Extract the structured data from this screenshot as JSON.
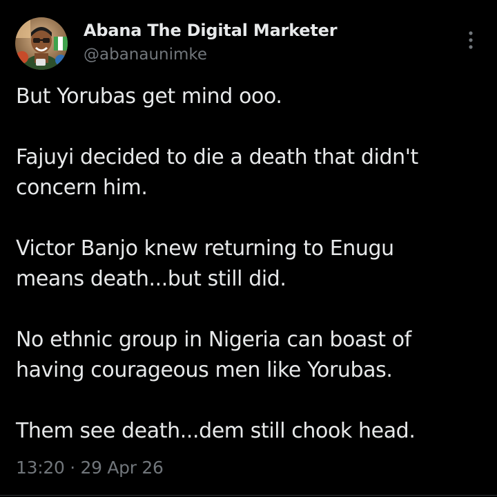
{
  "author": {
    "name": "Abana The Digital Marketer",
    "handle": "@abanaunimke",
    "avatar_icon": "profile-photo"
  },
  "menu": {
    "icon": "more-vertical-icon"
  },
  "tweet": {
    "paragraphs": [
      {
        "lines": [
          "But Yorubas get mind ooo."
        ]
      },
      {
        "lines": [
          "Fajuyi decided to die a death that didn't",
          "concern him."
        ]
      },
      {
        "lines": [
          "Victor Banjo knew returning to Enugu",
          "means death...but still did."
        ]
      },
      {
        "lines": [
          "No ethnic group in Nigeria can boast of",
          "having courageous men like Yorubas."
        ]
      },
      {
        "lines": [
          "Them see death...dem still chook head."
        ]
      }
    ],
    "time": "13:20",
    "separator": "·",
    "date": "29 Apr 26"
  },
  "colors": {
    "background": "#000000",
    "primary_text": "#e7e9ea",
    "secondary_text": "#71767b"
  }
}
